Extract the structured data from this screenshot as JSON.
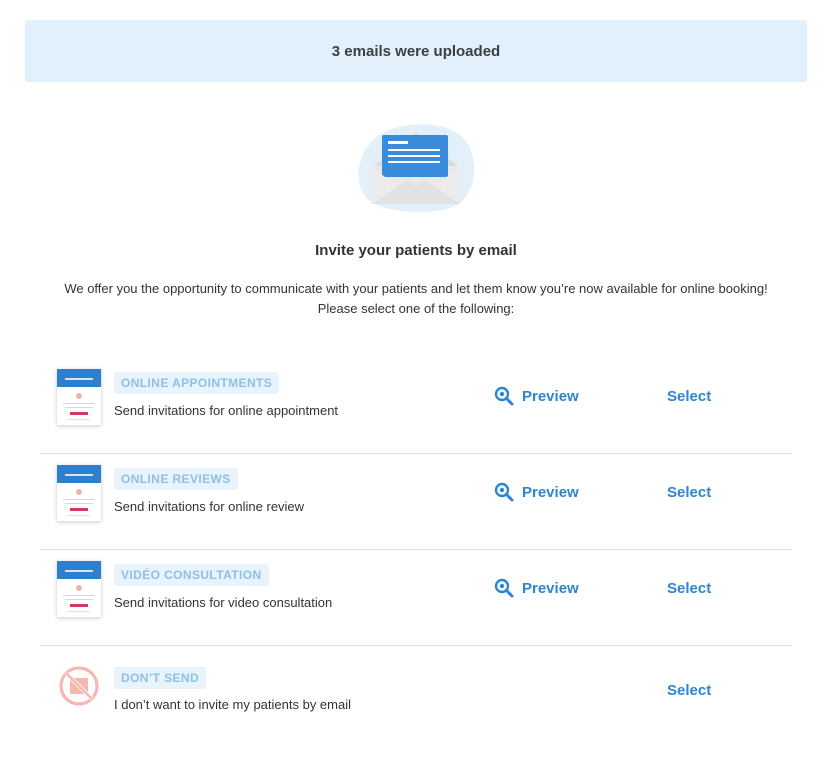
{
  "banner": {
    "text": "3 emails were uploaded"
  },
  "illustration": {
    "icon": "envelope-letter-icon"
  },
  "header": {
    "title": "Invite your patients by email",
    "description_line1": "We offer you the opportunity to communicate with your patients and let them know you’re now available for online booking!",
    "description_line2": "Please select one of the following:"
  },
  "colors": {
    "accent": "#2c86d1",
    "badge_bg": "#e8f3fc",
    "badge_text": "#8ec1e6",
    "banner_bg": "#e1f0fb",
    "no_send_icon": "#f4b8b0"
  },
  "options": [
    {
      "badge": "ONLINE APPOINTMENTS",
      "subtitle": "Send invitations for online appointment",
      "preview_label": "Preview",
      "select_label": "Select"
    },
    {
      "badge": "ONLINE REVIEWS",
      "subtitle": "Send invitations for online review",
      "preview_label": "Preview",
      "select_label": "Select"
    },
    {
      "badge": "VIDÉO CONSULTATION",
      "subtitle": "Send invitations for video consultation",
      "preview_label": "Preview",
      "select_label": "Select"
    },
    {
      "badge": "DON’T SEND",
      "subtitle": "I don’t want to invite my patients by email",
      "select_label": "Select"
    }
  ]
}
